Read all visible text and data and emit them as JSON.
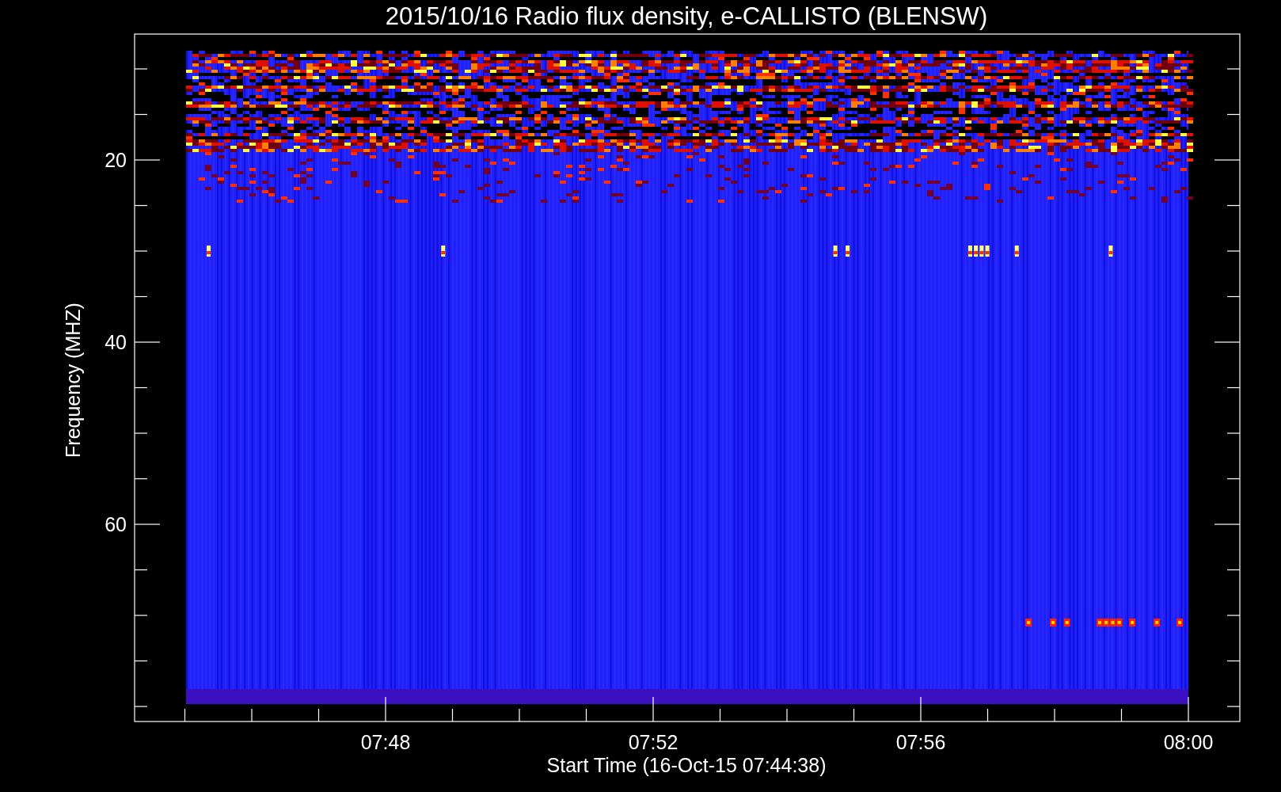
{
  "title": "2015/10/16  Radio flux density, e-CALLISTO (BLENSW)",
  "y_axis": {
    "label": "Frequency (MHZ)",
    "ticks": [
      "20",
      "40",
      "60"
    ]
  },
  "x_axis": {
    "label": "Start Time (16-Oct-15 07:44:38)",
    "ticks": [
      "07:48",
      "07:52",
      "07:56",
      "08:00"
    ]
  }
}
